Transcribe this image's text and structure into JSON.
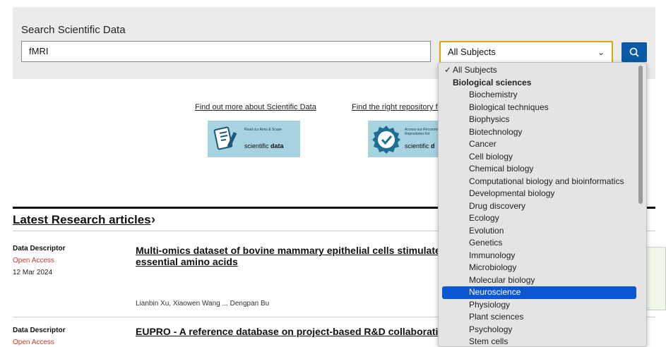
{
  "search": {
    "title": "Search Scientific Data",
    "query": "fMRI",
    "subject_selected": "All Subjects"
  },
  "promo": {
    "link1": "Find out more about Scientific Data",
    "link2": "Find the right repository fo",
    "banner1_small": "Read our Aims & Scope",
    "banner2_small": "Access our Recommended Repositories list",
    "brand_word1": "scientific",
    "brand_word2": "data",
    "brand2_word2": "d"
  },
  "latest": {
    "heading": "Latest Research articles",
    "arrow": "›",
    "articles": [
      {
        "type": "Data Descriptor",
        "access": "Open Access",
        "date": "12 Mar 2024",
        "title_line1": "Multi-omics dataset of bovine mammary epithelial cells stimulate",
        "title_line2": "essential amino acids",
        "authors": "Lianbin Xu, Xiaowen Wang ... Dengpan Bu"
      },
      {
        "type": "Data Descriptor",
        "access": "Open Access",
        "title_line1": "EUPRO - A reference database on project-based R&D collaborati"
      }
    ]
  },
  "dropdown": {
    "check": "✓",
    "options": [
      "All Subjects",
      "Biological sciences",
      "Biochemistry",
      "Biological techniques",
      "Biophysics",
      "Biotechnology",
      "Cancer",
      "Cell biology",
      "Chemical biology",
      "Computational biology and bioinformatics",
      "Developmental biology",
      "Drug discovery",
      "Ecology",
      "Evolution",
      "Genetics",
      "Immunology",
      "Microbiology",
      "Molecular biology",
      "Neuroscience",
      "Physiology",
      "Plant sciences",
      "Psychology",
      "Stem cells"
    ],
    "highlighted": "Neuroscience"
  },
  "colors": {
    "accent_blue": "#0a5aa8",
    "select_focus": "#e0a400",
    "highlight": "#0a57d1",
    "open_access": "#c0392b",
    "banner": "#a7d2df"
  }
}
